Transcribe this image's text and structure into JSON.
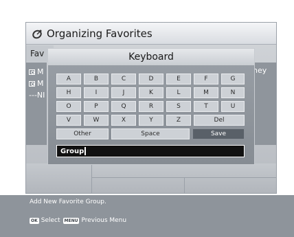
{
  "window": {
    "title": "Organizing Favorites",
    "icon": "satellite-icon",
    "tab_label": "Fav L",
    "channels": [
      "M",
      "M",
      "---NI"
    ],
    "right_partial_text": "ney"
  },
  "keyboard": {
    "title": "Keyboard",
    "rows": [
      [
        "A",
        "B",
        "C",
        "D",
        "E",
        "F",
        "G"
      ],
      [
        "H",
        "I",
        "J",
        "K",
        "L",
        "M",
        "N"
      ],
      [
        "O",
        "P",
        "Q",
        "R",
        "S",
        "T",
        "U"
      ],
      [
        "V",
        "W",
        "X",
        "Y",
        "Z",
        "Del"
      ]
    ],
    "bottom_keys": [
      "Other",
      "Space",
      "Save"
    ],
    "input_value": "Group"
  },
  "help": {
    "message": "Add New Favorite Group.",
    "hints": [
      {
        "button": "OK",
        "label": "Select"
      },
      {
        "button": "MENU",
        "label": "Previous Menu"
      }
    ]
  },
  "colors": {
    "selected_key": "#596068",
    "window_bg": "#c4c8cd",
    "help_bar": "#8e949b"
  }
}
